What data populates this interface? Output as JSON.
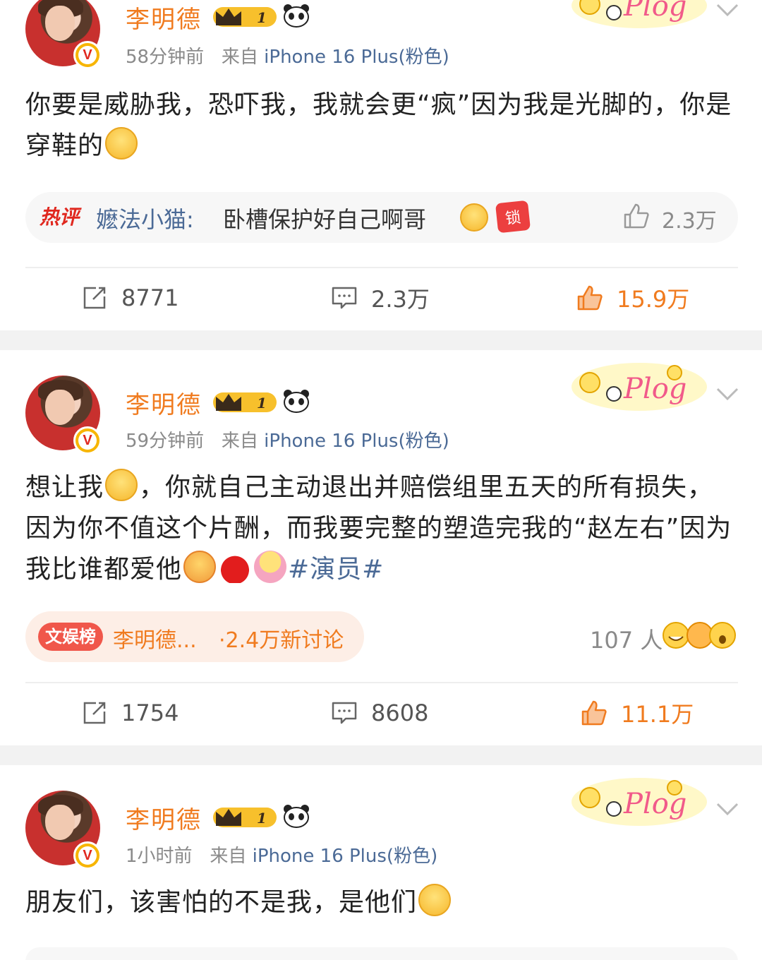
{
  "posts": [
    {
      "author": "李明德",
      "level": "1",
      "time": "58分钟前",
      "from_label": "来自",
      "device": "iPhone 16 Plus(粉色)",
      "text_parts": [
        "你要是威胁我，恐吓我，我就会更“疯”因为我是光脚的，你是穿鞋的"
      ],
      "emojis": [
        "grin-icon"
      ],
      "hot_comment": {
        "tag": "热评",
        "user": "嬷法小猫",
        "colon": ":",
        "text": "卧槽保护好自己啊哥",
        "likes": "2.3万"
      },
      "reposts": "8771",
      "comments": "2.3万",
      "likes": "15.9万"
    },
    {
      "author": "李明德",
      "level": "1",
      "time": "59分钟前",
      "from_label": "来自",
      "device": "iPhone 16 Plus(粉色)",
      "text_parts": [
        "想让我",
        "，你就自己主动退出并赔偿组里五天的所有损失，因为你不值这个片酬，而我要完整的塑造完我的“赵左右”因为我比谁都爱他"
      ],
      "topic": "#演员#",
      "emojis": [
        "zipper-mouth-icon",
        "fan-icon",
        "cup-icon",
        "flower-face-icon"
      ],
      "rank": {
        "tag": "文娱榜",
        "name": "李明德...",
        "discussion": "·2.4万新讨论"
      },
      "reaction_count": "107 人",
      "reposts": "1754",
      "comments": "8608",
      "likes": "11.1万"
    },
    {
      "author": "李明德",
      "level": "1",
      "time": "1小时前",
      "from_label": "来自",
      "device": "iPhone 16 Plus(粉色)",
      "text_parts": [
        "朋友们，该害怕的不是我，是他们"
      ],
      "emojis": [
        "smile-icon"
      ]
    }
  ],
  "colors": {
    "accent_orange": "#f07b1f",
    "link_blue": "#4b6a96",
    "hot_red": "#e0281f",
    "meta_gray": "#8a8a8a"
  },
  "icons": [
    "repost-icon",
    "comment-icon",
    "like-icon",
    "chevron-down-icon",
    "plog-sticker-icon",
    "level-crown-icon",
    "panda-icon",
    "verified-badge-icon"
  ]
}
